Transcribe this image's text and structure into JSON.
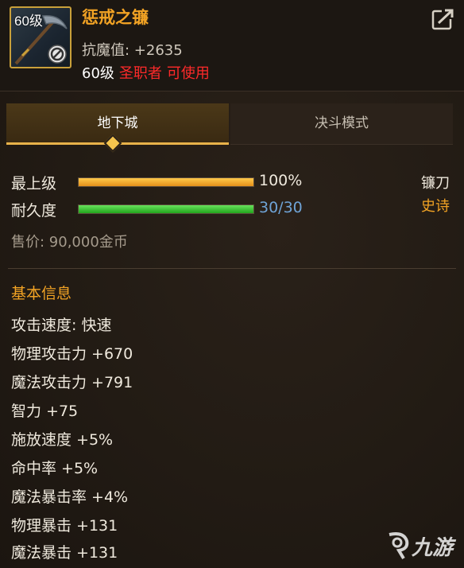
{
  "item": {
    "icon_level": "60级",
    "name": "惩戒之镰",
    "anti_magic": "抗魔值: +2635",
    "req_level": "60级",
    "req_class": "圣职者",
    "req_usable": "可使用"
  },
  "tabs": [
    {
      "label": "地下城",
      "active": true
    },
    {
      "label": "决斗模式",
      "active": false
    }
  ],
  "bars": {
    "upgrade": {
      "label": "最上级",
      "value_text": "100%",
      "fill": 1.0,
      "color": "#f0b032"
    },
    "durability": {
      "label": "耐久度",
      "value_text": "30/30",
      "fill": 1.0,
      "color": "#3bc534"
    }
  },
  "type_label": "镰刀",
  "grade_label": "史诗",
  "price": "售价: 90,000金币",
  "basic_info_title": "基本信息",
  "attributes": [
    "攻击速度: 快速",
    "物理攻击力 +670",
    "魔法攻击力 +791",
    "智力 +75",
    "施放速度 +5%",
    "命中率 +5%",
    "魔法暴击率 +4%",
    "物理暴击 +131",
    "魔法暴击 +131"
  ],
  "watermark": "九游",
  "colors": {
    "accent_gold": "#f2a324",
    "warning_red": "#ff2a2a",
    "durability_text": "#6fa3d6"
  }
}
